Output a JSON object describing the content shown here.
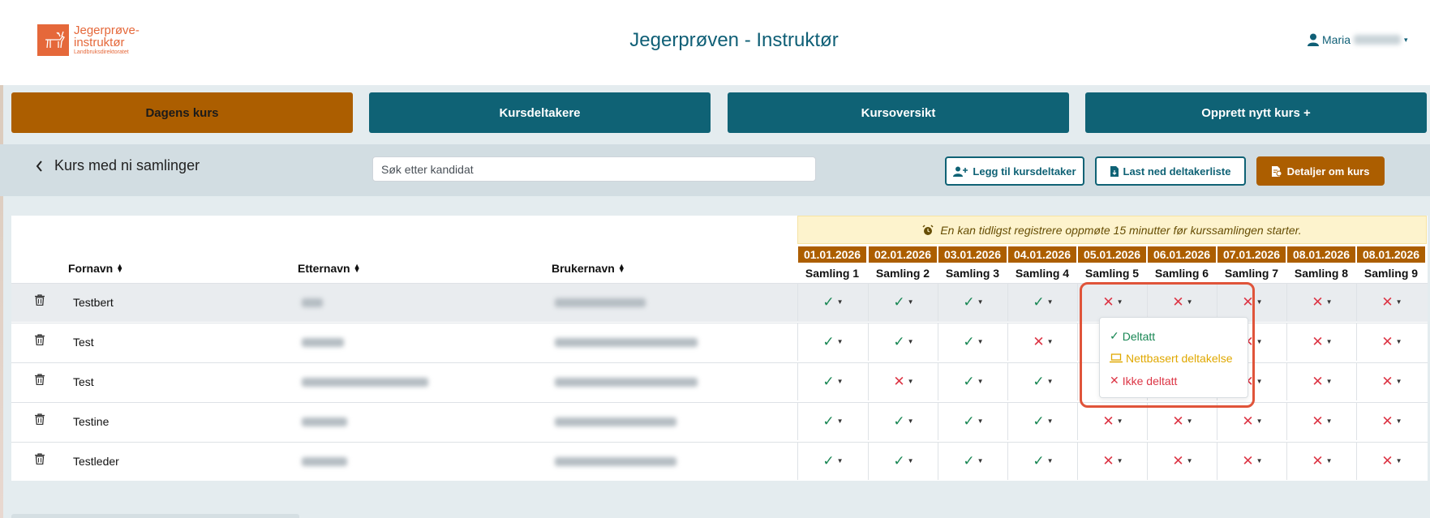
{
  "logo": {
    "line1": "Jegerprøve-",
    "line2": "instruktør",
    "sub": "Landbruksdirektoratet"
  },
  "app_title": "Jegerprøven - Instruktør",
  "user": {
    "name": "Maria"
  },
  "nav": [
    "Dagens kurs",
    "Kursdeltakere",
    "Kursoversikt",
    "Opprett nytt kurs +"
  ],
  "course_title": "Kurs med ni samlinger",
  "search": {
    "placeholder": "Søk etter kandidat"
  },
  "actions": {
    "add": "Legg til kursdeltaker",
    "download": "Last ned deltakerliste",
    "details": "Detaljer om kurs"
  },
  "notice": "En kan tidligst registrere oppmøte 15 minutter før kurssamlingen starter.",
  "columns": {
    "first": "Fornavn",
    "last": "Etternavn",
    "user": "Brukernavn"
  },
  "dates": [
    "01.01.2026",
    "02.01.2026",
    "03.01.2026",
    "04.01.2026",
    "05.01.2026",
    "06.01.2026",
    "07.01.2026",
    "08.01.2026",
    "08.01.2026"
  ],
  "sessions": [
    "Samling 1",
    "Samling 2",
    "Samling 3",
    "Samling 4",
    "Samling 5",
    "Samling 6",
    "Samling 7",
    "Samling 8",
    "Samling 9"
  ],
  "rows": [
    {
      "first": "Testbert",
      "attendance": [
        "ok",
        "ok",
        "ok",
        "ok",
        "no",
        "no",
        "no",
        "no",
        "no"
      ]
    },
    {
      "first": "Test",
      "attendance": [
        "ok",
        "ok",
        "ok",
        "no",
        "",
        "",
        "no",
        "no",
        "no"
      ]
    },
    {
      "first": "Test",
      "attendance": [
        "ok",
        "no",
        "ok",
        "ok",
        "",
        "",
        "no",
        "no",
        "no"
      ]
    },
    {
      "first": "Testine",
      "attendance": [
        "ok",
        "ok",
        "ok",
        "ok",
        "no",
        "no",
        "no",
        "no",
        "no"
      ]
    },
    {
      "first": "Testleder",
      "attendance": [
        "ok",
        "ok",
        "ok",
        "ok",
        "no",
        "no",
        "no",
        "no",
        "no"
      ]
    }
  ],
  "dropdown": {
    "attended": "Deltatt",
    "online": "Nettbasert deltakelse",
    "not_attended": "Ikke deltatt"
  },
  "colors": {
    "primary": "#0f6275",
    "active": "#ac5e00",
    "ok": "#198754",
    "no": "#dc3545",
    "warn": "#e0a800",
    "highlight": "#e0543a"
  }
}
